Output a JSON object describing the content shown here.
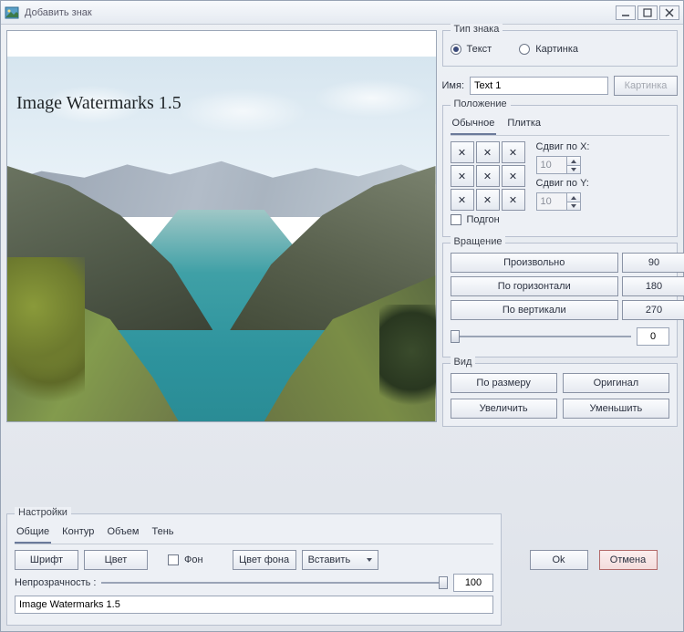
{
  "window": {
    "title": "Добавить знак"
  },
  "preview": {
    "watermark_text": "Image Watermarks 1.5"
  },
  "type": {
    "group": "Тип знака",
    "text_label": "Текст",
    "image_label": "Картинка"
  },
  "name": {
    "label": "Имя:",
    "value": "Text 1",
    "image_btn": "Картинка"
  },
  "position": {
    "group": "Положение",
    "tab_normal": "Обычное",
    "tab_tile": "Плитка",
    "cell": "✕",
    "shift_x_label": "Сдвиг по X:",
    "shift_x_value": "10",
    "shift_y_label": "Сдвиг по Y:",
    "shift_y_value": "10",
    "fit_label": "Подгон"
  },
  "rotation": {
    "group": "Вращение",
    "free": "Произвольно",
    "horiz": "По горизонтали",
    "vert": "По вертикали",
    "a90": "90",
    "a180": "180",
    "a270": "270",
    "slider_value": "0"
  },
  "view": {
    "group": "Вид",
    "fit": "По размеру",
    "orig": "Оригинал",
    "zoomin": "Увеличить",
    "zoomout": "Уменьшить"
  },
  "settings": {
    "group": "Настройки",
    "tab_general": "Общие",
    "tab_outline": "Контур",
    "tab_volume": "Объем",
    "tab_shadow": "Тень",
    "font_btn": "Шрифт",
    "color_btn": "Цвет",
    "bg_check": "Фон",
    "bgcolor_btn": "Цвет фона",
    "insert_btn": "Вставить",
    "opacity_label": "Непрозрачность :",
    "opacity_value": "100",
    "text_value": "Image Watermarks 1.5"
  },
  "actions": {
    "ok": "Ok",
    "cancel": "Отмена"
  }
}
